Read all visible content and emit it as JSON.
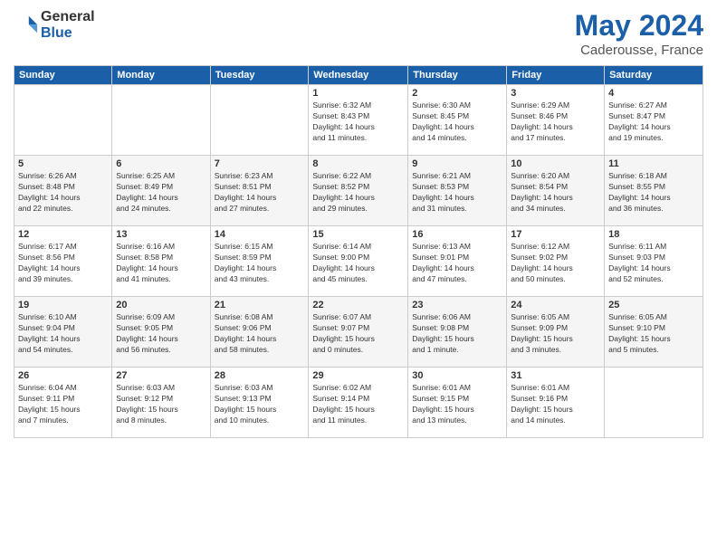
{
  "header": {
    "logo_line1": "General",
    "logo_line2": "Blue",
    "month_title": "May 2024",
    "location": "Caderousse, France"
  },
  "weekdays": [
    "Sunday",
    "Monday",
    "Tuesday",
    "Wednesday",
    "Thursday",
    "Friday",
    "Saturday"
  ],
  "weeks": [
    [
      {
        "day": "",
        "info": ""
      },
      {
        "day": "",
        "info": ""
      },
      {
        "day": "",
        "info": ""
      },
      {
        "day": "1",
        "info": "Sunrise: 6:32 AM\nSunset: 8:43 PM\nDaylight: 14 hours\nand 11 minutes."
      },
      {
        "day": "2",
        "info": "Sunrise: 6:30 AM\nSunset: 8:45 PM\nDaylight: 14 hours\nand 14 minutes."
      },
      {
        "day": "3",
        "info": "Sunrise: 6:29 AM\nSunset: 8:46 PM\nDaylight: 14 hours\nand 17 minutes."
      },
      {
        "day": "4",
        "info": "Sunrise: 6:27 AM\nSunset: 8:47 PM\nDaylight: 14 hours\nand 19 minutes."
      }
    ],
    [
      {
        "day": "5",
        "info": "Sunrise: 6:26 AM\nSunset: 8:48 PM\nDaylight: 14 hours\nand 22 minutes."
      },
      {
        "day": "6",
        "info": "Sunrise: 6:25 AM\nSunset: 8:49 PM\nDaylight: 14 hours\nand 24 minutes."
      },
      {
        "day": "7",
        "info": "Sunrise: 6:23 AM\nSunset: 8:51 PM\nDaylight: 14 hours\nand 27 minutes."
      },
      {
        "day": "8",
        "info": "Sunrise: 6:22 AM\nSunset: 8:52 PM\nDaylight: 14 hours\nand 29 minutes."
      },
      {
        "day": "9",
        "info": "Sunrise: 6:21 AM\nSunset: 8:53 PM\nDaylight: 14 hours\nand 31 minutes."
      },
      {
        "day": "10",
        "info": "Sunrise: 6:20 AM\nSunset: 8:54 PM\nDaylight: 14 hours\nand 34 minutes."
      },
      {
        "day": "11",
        "info": "Sunrise: 6:18 AM\nSunset: 8:55 PM\nDaylight: 14 hours\nand 36 minutes."
      }
    ],
    [
      {
        "day": "12",
        "info": "Sunrise: 6:17 AM\nSunset: 8:56 PM\nDaylight: 14 hours\nand 39 minutes."
      },
      {
        "day": "13",
        "info": "Sunrise: 6:16 AM\nSunset: 8:58 PM\nDaylight: 14 hours\nand 41 minutes."
      },
      {
        "day": "14",
        "info": "Sunrise: 6:15 AM\nSunset: 8:59 PM\nDaylight: 14 hours\nand 43 minutes."
      },
      {
        "day": "15",
        "info": "Sunrise: 6:14 AM\nSunset: 9:00 PM\nDaylight: 14 hours\nand 45 minutes."
      },
      {
        "day": "16",
        "info": "Sunrise: 6:13 AM\nSunset: 9:01 PM\nDaylight: 14 hours\nand 47 minutes."
      },
      {
        "day": "17",
        "info": "Sunrise: 6:12 AM\nSunset: 9:02 PM\nDaylight: 14 hours\nand 50 minutes."
      },
      {
        "day": "18",
        "info": "Sunrise: 6:11 AM\nSunset: 9:03 PM\nDaylight: 14 hours\nand 52 minutes."
      }
    ],
    [
      {
        "day": "19",
        "info": "Sunrise: 6:10 AM\nSunset: 9:04 PM\nDaylight: 14 hours\nand 54 minutes."
      },
      {
        "day": "20",
        "info": "Sunrise: 6:09 AM\nSunset: 9:05 PM\nDaylight: 14 hours\nand 56 minutes."
      },
      {
        "day": "21",
        "info": "Sunrise: 6:08 AM\nSunset: 9:06 PM\nDaylight: 14 hours\nand 58 minutes."
      },
      {
        "day": "22",
        "info": "Sunrise: 6:07 AM\nSunset: 9:07 PM\nDaylight: 15 hours\nand 0 minutes."
      },
      {
        "day": "23",
        "info": "Sunrise: 6:06 AM\nSunset: 9:08 PM\nDaylight: 15 hours\nand 1 minute."
      },
      {
        "day": "24",
        "info": "Sunrise: 6:05 AM\nSunset: 9:09 PM\nDaylight: 15 hours\nand 3 minutes."
      },
      {
        "day": "25",
        "info": "Sunrise: 6:05 AM\nSunset: 9:10 PM\nDaylight: 15 hours\nand 5 minutes."
      }
    ],
    [
      {
        "day": "26",
        "info": "Sunrise: 6:04 AM\nSunset: 9:11 PM\nDaylight: 15 hours\nand 7 minutes."
      },
      {
        "day": "27",
        "info": "Sunrise: 6:03 AM\nSunset: 9:12 PM\nDaylight: 15 hours\nand 8 minutes."
      },
      {
        "day": "28",
        "info": "Sunrise: 6:03 AM\nSunset: 9:13 PM\nDaylight: 15 hours\nand 10 minutes."
      },
      {
        "day": "29",
        "info": "Sunrise: 6:02 AM\nSunset: 9:14 PM\nDaylight: 15 hours\nand 11 minutes."
      },
      {
        "day": "30",
        "info": "Sunrise: 6:01 AM\nSunset: 9:15 PM\nDaylight: 15 hours\nand 13 minutes."
      },
      {
        "day": "31",
        "info": "Sunrise: 6:01 AM\nSunset: 9:16 PM\nDaylight: 15 hours\nand 14 minutes."
      },
      {
        "day": "",
        "info": ""
      }
    ]
  ]
}
